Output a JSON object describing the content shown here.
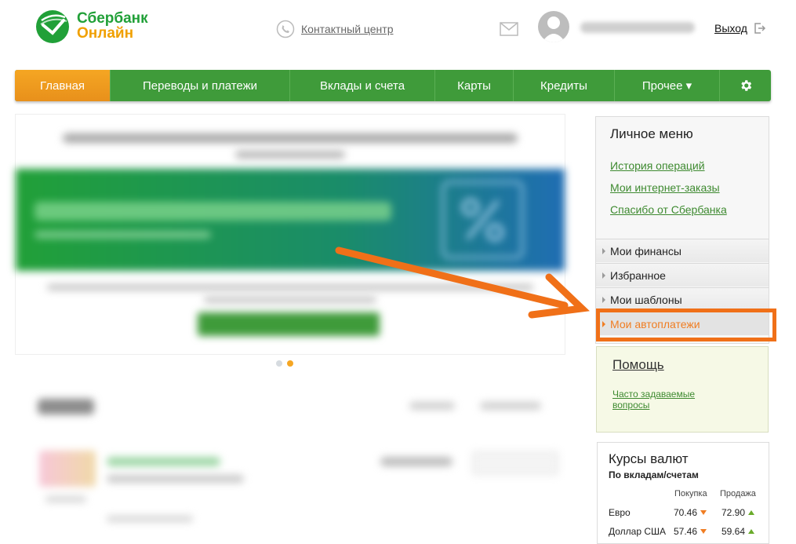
{
  "header": {
    "logo_line1": "Сбербанк",
    "logo_line2": "Онлайн",
    "contact_label": "Контактный центр",
    "logout_label": "Выход"
  },
  "nav": {
    "items": [
      {
        "label": "Главная",
        "active": true
      },
      {
        "label": "Переводы и платежи"
      },
      {
        "label": "Вклады и счета"
      },
      {
        "label": "Карты"
      },
      {
        "label": "Кредиты"
      },
      {
        "label": "Прочее ▾"
      }
    ],
    "settings_icon": "gear-icon"
  },
  "personal_menu": {
    "title": "Личное меню",
    "links": [
      "История операций",
      "Мои интернет-заказы",
      "Спасибо от Сбербанка"
    ],
    "sections": [
      "Мои финансы",
      "Избранное",
      "Мои шаблоны",
      "Мои автоплатежи"
    ]
  },
  "help": {
    "title": "Помощь",
    "faq_link": "Часто задаваемые вопросы"
  },
  "rates": {
    "title": "Курсы валют",
    "subtitle": "По вкладам/счетам",
    "col_buy": "Покупка",
    "col_sell": "Продажа",
    "rows": [
      {
        "currency": "Евро",
        "buy": "70.46",
        "sell": "72.90"
      },
      {
        "currency": "Доллар США",
        "buy": "57.46",
        "sell": "59.64"
      }
    ]
  },
  "colors": {
    "brand_green": "#3f9b3a",
    "active_orange": "#f5a623",
    "highlight_orange": "#f07018"
  }
}
